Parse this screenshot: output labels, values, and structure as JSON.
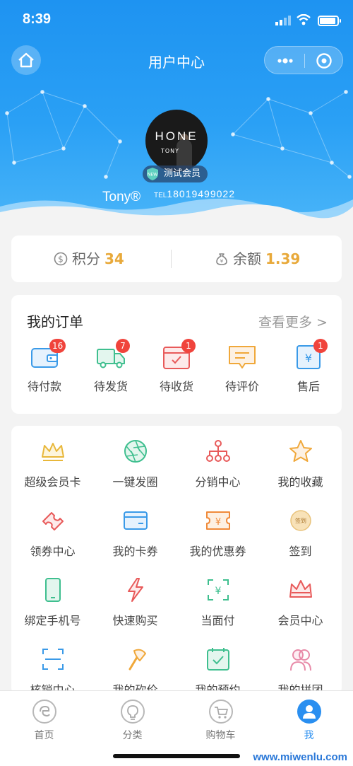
{
  "status_bar": {
    "time": "8:39"
  },
  "nav": {
    "title": "用户中心"
  },
  "profile": {
    "avatar_brand": "HONE",
    "avatar_sub": "TONY",
    "member_badge": "测试会员",
    "badge_icon_text": "NEW",
    "username": "Tony®",
    "tel_prefix": "TEL",
    "tel": "18019499022"
  },
  "balance": {
    "points_label": "积分",
    "points_value": "34",
    "balance_label": "余额",
    "balance_value": "1.39"
  },
  "orders": {
    "title": "我的订单",
    "more": "查看更多 >",
    "items": [
      {
        "label": "待付款",
        "count": "16",
        "icon": "wallet-icon"
      },
      {
        "label": "待发货",
        "count": "7",
        "icon": "truck-icon"
      },
      {
        "label": "待收货",
        "count": "1",
        "icon": "parcel-icon"
      },
      {
        "label": "待评价",
        "count": "",
        "icon": "comment-icon"
      },
      {
        "label": "售后",
        "count": "1",
        "icon": "refund-icon"
      }
    ]
  },
  "features": [
    {
      "label": "超级会员卡",
      "icon": "crown-icon",
      "color": "#e8b73a"
    },
    {
      "label": "一键发圈",
      "icon": "aperture-icon",
      "color": "#3fbf8f"
    },
    {
      "label": "分销中心",
      "icon": "network-icon",
      "color": "#e85a5a"
    },
    {
      "label": "我的收藏",
      "icon": "star-icon",
      "color": "#f0a83a"
    },
    {
      "label": "领券中心",
      "icon": "ticket-icon",
      "color": "#e85a5a"
    },
    {
      "label": "我的卡券",
      "icon": "card-icon",
      "color": "#3a9ae8"
    },
    {
      "label": "我的优惠券",
      "icon": "coupon-yen-icon",
      "color": "#f08a3a"
    },
    {
      "label": "签到",
      "icon": "checkin-icon",
      "color": "#e8a93a",
      "icon_text": "签到"
    },
    {
      "label": "绑定手机号",
      "icon": "phone-icon",
      "color": "#3fbf8f"
    },
    {
      "label": "快速购买",
      "icon": "lightning-icon",
      "color": "#e85a5a"
    },
    {
      "label": "当面付",
      "icon": "scan-pay-icon",
      "color": "#3fbf8f"
    },
    {
      "label": "会员中心",
      "icon": "crown-outline-icon",
      "color": "#e85a5a"
    },
    {
      "label": "核销中心",
      "icon": "scan-icon",
      "color": "#3a9ae8"
    },
    {
      "label": "我的砍价",
      "icon": "axe-icon",
      "color": "#f0a83a"
    },
    {
      "label": "我的预约",
      "icon": "calendar-check-icon",
      "color": "#3fbf8f"
    },
    {
      "label": "我的拼团",
      "icon": "group-icon",
      "color": "#e88aa8"
    }
  ],
  "tabbar": [
    {
      "label": "首页",
      "icon": "home-icon"
    },
    {
      "label": "分类",
      "icon": "bulb-icon"
    },
    {
      "label": "购物车",
      "icon": "cart-icon"
    },
    {
      "label": "我",
      "icon": "user-icon",
      "active": true
    }
  ],
  "watermark": "www.miwenlu.com",
  "colors": {
    "header": "#1e93f1",
    "accent": "#2a8ff0",
    "badge": "#f0443c",
    "points": "#e8a93a"
  }
}
